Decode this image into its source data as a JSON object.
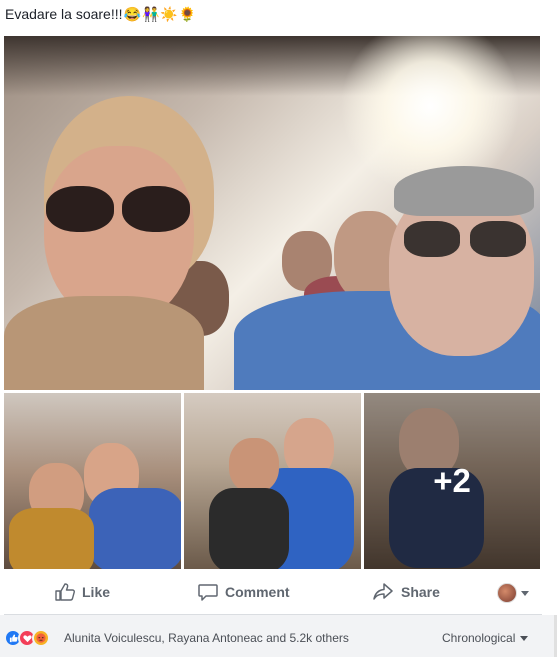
{
  "post": {
    "caption_text": "Evadare la soare!!!",
    "caption_emojis": [
      "😂",
      "👫",
      "☀️",
      "🌻"
    ]
  },
  "gallery": {
    "more_count": "+2"
  },
  "actions": {
    "like": "Like",
    "comment": "Comment",
    "share": "Share"
  },
  "reactions": {
    "summary": "Alunita Voiculescu, Rayana Antoneac and 5.2k others",
    "order_label": "Chronological",
    "types": [
      "like",
      "love",
      "angry"
    ]
  },
  "colors": {
    "like": "#2078f4",
    "love": "#f33e58",
    "angry": "#f7b125",
    "action_text": "#606770",
    "bar_bg": "#f2f3f5"
  }
}
